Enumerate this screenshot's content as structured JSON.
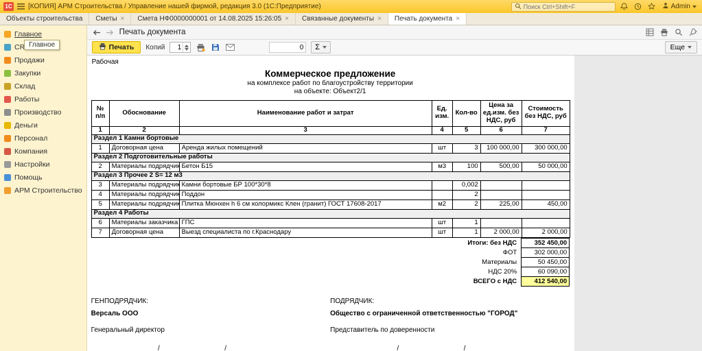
{
  "colors": {
    "brand_yellow": "#fbc62a",
    "sidebar_bg": "#fdf3cf",
    "print_button_bg": "#ffe24d",
    "highlight_cell": "#ffff9c"
  },
  "window": {
    "logo": "1С",
    "title": "[КОПИЯ] АРМ Строительства / Управление нашей фирмой, редакция 3.0  (1С:Предприятие)",
    "search_placeholder": "Поиск Ctrl+Shift+F",
    "user": "Admin"
  },
  "tabs": {
    "close_glyph": "×",
    "items": [
      {
        "label": "Объекты строительства"
      },
      {
        "label": "Сметы"
      },
      {
        "label": "Смета НФ0000000001 от 14.08.2025 15:26:05"
      },
      {
        "label": "Связанные документы"
      },
      {
        "label": "Печать документа"
      }
    ]
  },
  "sidebar": {
    "tooltip": "Главное",
    "items": [
      {
        "label": "Главное"
      },
      {
        "label": "CRM"
      },
      {
        "label": "Продажи"
      },
      {
        "label": "Закупки"
      },
      {
        "label": "Склад"
      },
      {
        "label": "Работы"
      },
      {
        "label": "Производство"
      },
      {
        "label": "Деньги"
      },
      {
        "label": "Персонал"
      },
      {
        "label": "Компания"
      },
      {
        "label": "Настройки"
      },
      {
        "label": "Помощь"
      },
      {
        "label": "АРМ Строительство"
      }
    ]
  },
  "content": {
    "title": "Печать документа",
    "toolbar": {
      "print_label": "Печать",
      "copies_label": "Копий",
      "copies_value": "1",
      "autosum_value": "0",
      "sum_label": "Σ",
      "more_label": "Еще"
    }
  },
  "document": {
    "corner_label": "Рабочая",
    "title": "Коммерческое предложение",
    "subtitle1": "на комплексе работ по благоустройству территории",
    "subtitle2": "на объекте: Объект2/1",
    "table": {
      "headers": [
        "№ п/п",
        "Обоснование",
        "Наименование работ и затрат",
        "Ед. изм.",
        "Кол-во",
        "Цена за ед.изм. без НДС, руб",
        "Стоимость без НДС, руб"
      ],
      "header_numbers": [
        "1",
        "2",
        "3",
        "4",
        "5",
        "6",
        "7"
      ],
      "rows": [
        {
          "type": "section",
          "label": "Раздел 1 Камни бортовые"
        },
        {
          "type": "item",
          "num": "1",
          "basis": "Договорная цена",
          "name": "Аренда жилых помещений",
          "unit": "шт",
          "qty": "3",
          "price": "100 000,00",
          "cost": "300 000,00"
        },
        {
          "type": "section",
          "label": "Раздел 2 Подготовительные работы"
        },
        {
          "type": "item",
          "num": "2",
          "basis": "Материалы подрядчика",
          "name": "Бетон Б15",
          "unit": "м3",
          "qty": "100",
          "price": "500,00",
          "cost": "50 000,00"
        },
        {
          "type": "section",
          "label": "Раздел 3 Прочее 2 S= 12 м3"
        },
        {
          "type": "item",
          "num": "3",
          "basis": "Материалы подрядчика",
          "name": "Камни бортовые БР 100*30*8",
          "unit": "",
          "qty": "0,002",
          "price": "",
          "cost": ""
        },
        {
          "type": "item",
          "num": "4",
          "basis": "Материалы подрядчика",
          "name": "Поддон",
          "unit": "",
          "qty": "2",
          "price": "",
          "cost": ""
        },
        {
          "type": "item",
          "num": "5",
          "basis": "Материалы подрядчика",
          "name": "Плитка Мюнхен h 6 см колормикс Клен (гранит) ГОСТ 17608-2017",
          "unit": "м2",
          "qty": "2",
          "price": "225,00",
          "cost": "450,00"
        },
        {
          "type": "section",
          "label": "Раздел 4 Работы"
        },
        {
          "type": "item",
          "num": "6",
          "basis": "Материалы заказчика",
          "name": "ГПС",
          "unit": "шт",
          "qty": "1",
          "price": "",
          "cost": ""
        },
        {
          "type": "item",
          "num": "7",
          "basis": "Договорная цена",
          "name": "Выезд специалиста по г.Краснодару",
          "unit": "шт",
          "qty": "1",
          "price": "2 000,00",
          "cost": "2 000,00"
        }
      ]
    },
    "totals": [
      {
        "label": "Итоги: без НДС",
        "value": "352 450,00"
      },
      {
        "label": "ФОТ",
        "value": "302 000,00"
      },
      {
        "label": "Материалы",
        "value": "50 450,00"
      },
      {
        "label": "НДС 20%",
        "value": "60 090,00"
      },
      {
        "label": "ВСЕГО с НДС",
        "value": "412 540,00"
      }
    ],
    "signatures": {
      "left_role": "ГЕНПОДРЯДЧИК:",
      "left_company": "Версаль ООО",
      "left_position": "Генеральный директор",
      "left_line": "_________________ /_________________/",
      "right_role": "ПОДРЯДЧИК:",
      "right_company": "Общество с ограниченной ответственностью \"ГОРОД\"",
      "right_position": "Представитель по доверенности",
      "right_line": "_________________ /_________________/"
    }
  }
}
